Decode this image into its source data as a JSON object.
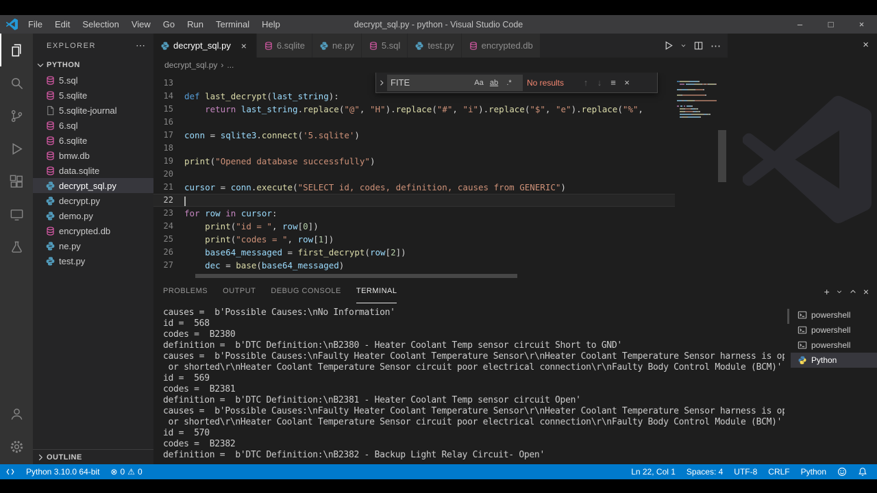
{
  "window": {
    "title": "decrypt_sql.py - python - Visual Studio Code",
    "menus": [
      "File",
      "Edit",
      "Selection",
      "View",
      "Go",
      "Run",
      "Terminal",
      "Help"
    ]
  },
  "icons": {
    "close": "×",
    "more": "⋯",
    "minimize": "–",
    "maximize": "□",
    "plus": "+",
    "arrow_up": "↑",
    "arrow_down": "↓",
    "in_selection": "≡",
    "breadcrumb_sep": "›",
    "error": "⊗",
    "warning": "⚠"
  },
  "colors": {
    "accent": "#007acc",
    "editor_background": "#1e1e1e",
    "sidebar_background": "#252526",
    "activitybar_background": "#333333",
    "selection_row": "#37373d"
  },
  "activity_bar": {
    "items": [
      "explorer",
      "search",
      "source-control",
      "run-and-debug",
      "extensions",
      "remote-explorer",
      "testing"
    ],
    "bottom": [
      "accounts",
      "settings"
    ],
    "active": "explorer"
  },
  "sidebar": {
    "title": "EXPLORER",
    "folder": "PYTHON",
    "outline": "OUTLINE",
    "files": [
      {
        "name": "5.sql",
        "type": "db"
      },
      {
        "name": "5.sqlite",
        "type": "db"
      },
      {
        "name": "5.sqlite-journal",
        "type": "file"
      },
      {
        "name": "6.sql",
        "type": "db"
      },
      {
        "name": "6.sqlite",
        "type": "db"
      },
      {
        "name": "bmw.db",
        "type": "db"
      },
      {
        "name": "data.sqlite",
        "type": "db"
      },
      {
        "name": "decrypt_sql.py",
        "type": "py",
        "selected": true
      },
      {
        "name": "decrypt.py",
        "type": "py"
      },
      {
        "name": "demo.py",
        "type": "py"
      },
      {
        "name": "encrypted.db",
        "type": "db"
      },
      {
        "name": "ne.py",
        "type": "py"
      },
      {
        "name": "test.py",
        "type": "py"
      }
    ]
  },
  "tabs": [
    {
      "label": "decrypt_sql.py",
      "type": "py",
      "active": true
    },
    {
      "label": "6.sqlite",
      "type": "db"
    },
    {
      "label": "ne.py",
      "type": "py"
    },
    {
      "label": "5.sql",
      "type": "db"
    },
    {
      "label": "test.py",
      "type": "py"
    },
    {
      "label": "encrypted.db",
      "type": "db"
    }
  ],
  "breadcrumb": {
    "file": "decrypt_sql.py",
    "rest": "..."
  },
  "find": {
    "query": "FITE",
    "match_case": "Aa",
    "whole_word": "ab",
    "regex": ".*",
    "results": "No results"
  },
  "editor": {
    "current_line": 22,
    "lines": [
      {
        "n": 13,
        "toks": []
      },
      {
        "n": 14,
        "toks": [
          {
            "c": "k",
            "t": "def "
          },
          {
            "c": "f",
            "t": "last_decrypt"
          },
          {
            "c": "p",
            "t": "("
          },
          {
            "c": "v",
            "t": "last_string"
          },
          {
            "c": "p",
            "t": "):"
          }
        ]
      },
      {
        "n": 15,
        "toks": [
          {
            "c": "p",
            "t": "    "
          },
          {
            "c": "c",
            "t": "return"
          },
          {
            "c": "p",
            "t": " "
          },
          {
            "c": "v",
            "t": "last_string"
          },
          {
            "c": "p",
            "t": "."
          },
          {
            "c": "f",
            "t": "replace"
          },
          {
            "c": "p",
            "t": "("
          },
          {
            "c": "s",
            "t": "\"@\""
          },
          {
            "c": "p",
            "t": ", "
          },
          {
            "c": "s",
            "t": "\"H\""
          },
          {
            "c": "p",
            "t": ")."
          },
          {
            "c": "f",
            "t": "replace"
          },
          {
            "c": "p",
            "t": "("
          },
          {
            "c": "s",
            "t": "\"#\""
          },
          {
            "c": "p",
            "t": ", "
          },
          {
            "c": "s",
            "t": "\"i\""
          },
          {
            "c": "p",
            "t": ")."
          },
          {
            "c": "f",
            "t": "replace"
          },
          {
            "c": "p",
            "t": "("
          },
          {
            "c": "s",
            "t": "\"$\""
          },
          {
            "c": "p",
            "t": ", "
          },
          {
            "c": "s",
            "t": "\"e\""
          },
          {
            "c": "p",
            "t": ")."
          },
          {
            "c": "f",
            "t": "replace"
          },
          {
            "c": "p",
            "t": "("
          },
          {
            "c": "s",
            "t": "\"%\""
          },
          {
            "c": "p",
            "t": ","
          }
        ]
      },
      {
        "n": 16,
        "toks": []
      },
      {
        "n": 17,
        "toks": [
          {
            "c": "v",
            "t": "conn"
          },
          {
            "c": "p",
            "t": " = "
          },
          {
            "c": "v",
            "t": "sqlite3"
          },
          {
            "c": "p",
            "t": "."
          },
          {
            "c": "f",
            "t": "connect"
          },
          {
            "c": "p",
            "t": "("
          },
          {
            "c": "s",
            "t": "'5.sqlite'"
          },
          {
            "c": "p",
            "t": ")"
          }
        ]
      },
      {
        "n": 18,
        "toks": []
      },
      {
        "n": 19,
        "toks": [
          {
            "c": "f",
            "t": "print"
          },
          {
            "c": "p",
            "t": "("
          },
          {
            "c": "s",
            "t": "\"Opened database successfully\""
          },
          {
            "c": "p",
            "t": ")"
          }
        ]
      },
      {
        "n": 20,
        "toks": []
      },
      {
        "n": 21,
        "toks": [
          {
            "c": "v",
            "t": "cursor"
          },
          {
            "c": "p",
            "t": " = "
          },
          {
            "c": "v",
            "t": "conn"
          },
          {
            "c": "p",
            "t": "."
          },
          {
            "c": "f",
            "t": "execute"
          },
          {
            "c": "p",
            "t": "("
          },
          {
            "c": "s",
            "t": "\"SELECT id, codes, definition, causes from GENERIC\""
          },
          {
            "c": "p",
            "t": ")"
          }
        ]
      },
      {
        "n": 22,
        "toks": []
      },
      {
        "n": 23,
        "toks": [
          {
            "c": "c",
            "t": "for"
          },
          {
            "c": "p",
            "t": " "
          },
          {
            "c": "v",
            "t": "row"
          },
          {
            "c": "p",
            "t": " "
          },
          {
            "c": "c",
            "t": "in"
          },
          {
            "c": "p",
            "t": " "
          },
          {
            "c": "v",
            "t": "cursor"
          },
          {
            "c": "p",
            "t": ":"
          }
        ]
      },
      {
        "n": 24,
        "toks": [
          {
            "c": "p",
            "t": "    "
          },
          {
            "c": "f",
            "t": "print"
          },
          {
            "c": "p",
            "t": "("
          },
          {
            "c": "s",
            "t": "\"id = \""
          },
          {
            "c": "p",
            "t": ", "
          },
          {
            "c": "v",
            "t": "row"
          },
          {
            "c": "p",
            "t": "["
          },
          {
            "c": "n",
            "t": "0"
          },
          {
            "c": "p",
            "t": "])"
          }
        ]
      },
      {
        "n": 25,
        "toks": [
          {
            "c": "p",
            "t": "    "
          },
          {
            "c": "f",
            "t": "print"
          },
          {
            "c": "p",
            "t": "("
          },
          {
            "c": "s",
            "t": "\"codes = \""
          },
          {
            "c": "p",
            "t": ", "
          },
          {
            "c": "v",
            "t": "row"
          },
          {
            "c": "p",
            "t": "["
          },
          {
            "c": "n",
            "t": "1"
          },
          {
            "c": "p",
            "t": "])"
          }
        ]
      },
      {
        "n": 26,
        "toks": [
          {
            "c": "p",
            "t": "    "
          },
          {
            "c": "v",
            "t": "base64_messaged"
          },
          {
            "c": "p",
            "t": " = "
          },
          {
            "c": "f",
            "t": "first_decrypt"
          },
          {
            "c": "p",
            "t": "("
          },
          {
            "c": "v",
            "t": "row"
          },
          {
            "c": "p",
            "t": "["
          },
          {
            "c": "n",
            "t": "2"
          },
          {
            "c": "p",
            "t": "])"
          }
        ]
      },
      {
        "n": 27,
        "toks": [
          {
            "c": "p",
            "t": "    "
          },
          {
            "c": "v",
            "t": "dec"
          },
          {
            "c": "p",
            "t": " = "
          },
          {
            "c": "f",
            "t": "base"
          },
          {
            "c": "p",
            "t": "("
          },
          {
            "c": "v",
            "t": "base64_messaged"
          },
          {
            "c": "p",
            "t": ")"
          }
        ]
      }
    ]
  },
  "panel": {
    "tabs": [
      {
        "label": "PROBLEMS"
      },
      {
        "label": "OUTPUT"
      },
      {
        "label": "DEBUG CONSOLE"
      },
      {
        "label": "TERMINAL",
        "active": true
      }
    ],
    "terminal_lines": [
      "causes =  b'Possible Causes:\\nNo Information'",
      "id =  568",
      "codes =  B2380",
      "definition =  b'DTC Definition:\\nB2380 - Heater Coolant Temp sensor circuit Short to GND'",
      "causes =  b'Possible Causes:\\nFaulty Heater Coolant Temperature Sensor\\r\\nHeater Coolant Temperature Sensor harness is open",
      " or shorted\\r\\nHeater Coolant Temperature Sensor circuit poor electrical connection\\r\\nFaulty Body Control Module (BCM)'",
      "id =  569",
      "codes =  B2381",
      "definition =  b'DTC Definition:\\nB2381 - Heater Coolant Temp sensor circuit Open'",
      "causes =  b'Possible Causes:\\nFaulty Heater Coolant Temperature Sensor\\r\\nHeater Coolant Temperature Sensor harness is open",
      " or shorted\\r\\nHeater Coolant Temperature Sensor circuit poor electrical connection\\r\\nFaulty Body Control Module (BCM)'",
      "id =  570",
      "codes =  B2382",
      "definition =  b'DTC Definition:\\nB2382 - Backup Light Relay Circuit- Open'"
    ],
    "instances": [
      {
        "label": "powershell",
        "icon": "terminal"
      },
      {
        "label": "powershell",
        "icon": "terminal"
      },
      {
        "label": "powershell",
        "icon": "terminal"
      },
      {
        "label": "Python",
        "icon": "python",
        "selected": true
      }
    ]
  },
  "status_bar": {
    "python_version": "Python 3.10.0 64-bit",
    "errors": "0",
    "warnings": "0",
    "line_col": "Ln 22, Col 1",
    "spaces": "Spaces: 4",
    "encoding": "UTF-8",
    "eol": "CRLF",
    "language": "Python"
  }
}
